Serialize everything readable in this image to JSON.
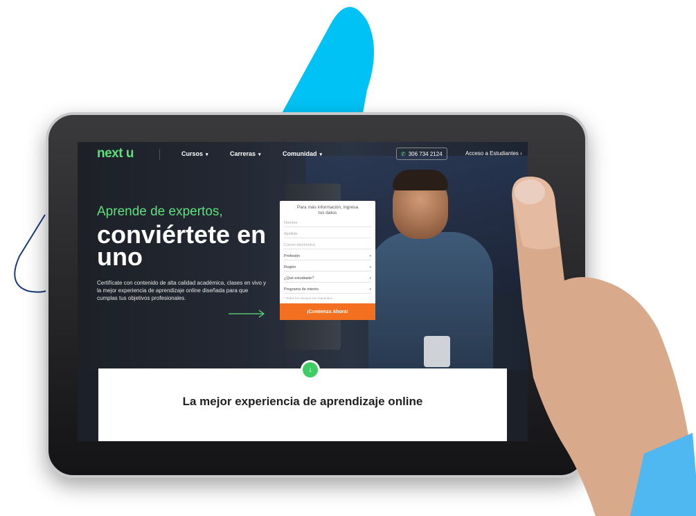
{
  "brand": {
    "logo_text": "next u",
    "colors": {
      "accent_green": "#5fe07c",
      "cta_orange": "#f37021",
      "decor_blue": "#00c2f5"
    }
  },
  "nav": {
    "items": [
      {
        "label": "Cursos"
      },
      {
        "label": "Carreras"
      },
      {
        "label": "Comunidad"
      }
    ],
    "phone": "306 734 2124",
    "students_link": "Acceso a Estudiantes"
  },
  "hero": {
    "headline_small": "Aprende de expertos,",
    "headline_big": "conviértete en uno",
    "description": "Certifícate con contenido de alta calidad académica, clases en vivo y la mejor experiencia de aprendizaje online diseñada para que cumplas tus objetivos profesionales."
  },
  "form": {
    "title": "Para más información, ingresa tus datos",
    "fields": {
      "name": "Nombre",
      "lastname": "Apellido",
      "email": "Correo electrónico",
      "profession": "Profesión",
      "region": "Región",
      "study_level": "¿Qué estudiaste?",
      "program": "Programa de interés"
    },
    "note": "* Todos los campos son requeridos",
    "submit_label": "¡Comienza Ahora!"
  },
  "info_card": {
    "title": "La mejor experiencia de aprendizaje online"
  },
  "icons": [
    "phone-icon",
    "chevron-right-icon",
    "arrow-right-icon",
    "arrow-down-icon",
    "chevron-down-icon"
  ]
}
